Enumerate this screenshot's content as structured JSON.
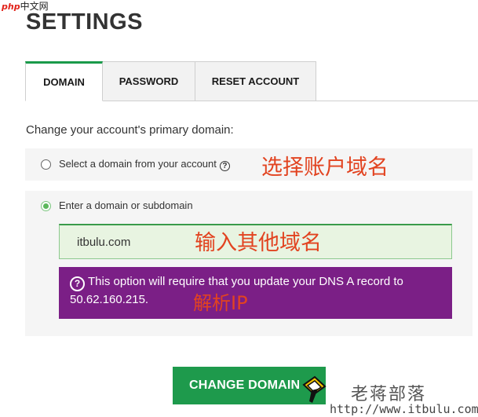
{
  "watermark_top": {
    "brand": "php",
    "site": "中文网"
  },
  "page": {
    "title": "SETTINGS"
  },
  "tabs": [
    {
      "label": "DOMAIN",
      "active": true
    },
    {
      "label": "PASSWORD",
      "active": false
    },
    {
      "label": "RESET ACCOUNT",
      "active": false
    }
  ],
  "intro": "Change your account's primary domain:",
  "options": {
    "select_account": {
      "label": "Select a domain from your account",
      "help_icon": "?",
      "selected": false
    },
    "enter_domain": {
      "label": "Enter a domain or subdomain",
      "selected": true
    }
  },
  "domain_input": {
    "value": "itbulu.com"
  },
  "dns_notice": {
    "icon": "?",
    "text": "This option will require that you update your DNS A record to 50.62.160.215."
  },
  "annotations": {
    "select_account": "选择账户域名",
    "enter_other": "输入其他域名",
    "resolve_ip": "解析IP"
  },
  "actions": {
    "change_domain": "CHANGE DOMAIN"
  },
  "watermark": {
    "name": "老蒋部落",
    "url": "http://www.itbulu.com"
  },
  "colors": {
    "accent_green": "#1e9a4c",
    "notice_purple": "#7b1f86",
    "input_bg": "#e8f4e1",
    "annotation_red": "#e24320"
  }
}
